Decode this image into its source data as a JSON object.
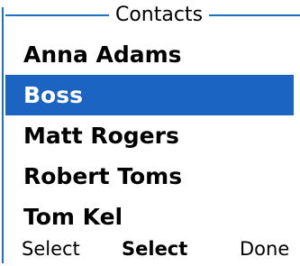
{
  "screen": {
    "title": "Contacts"
  },
  "colors": {
    "accent": "#1d6fc4",
    "selection_background": "#1c64c2",
    "selection_text": "#ffffff",
    "text": "#000000",
    "background": "#ffffff"
  },
  "contacts": [
    {
      "name": "Anna Adams",
      "selected": false
    },
    {
      "name": "Boss",
      "selected": true
    },
    {
      "name": "Matt Rogers",
      "selected": false
    },
    {
      "name": "Robert Toms",
      "selected": false
    },
    {
      "name": "Tom Kel",
      "selected": false
    }
  ],
  "softkeys": {
    "left": "Select",
    "center": "Select",
    "right": "Done"
  }
}
